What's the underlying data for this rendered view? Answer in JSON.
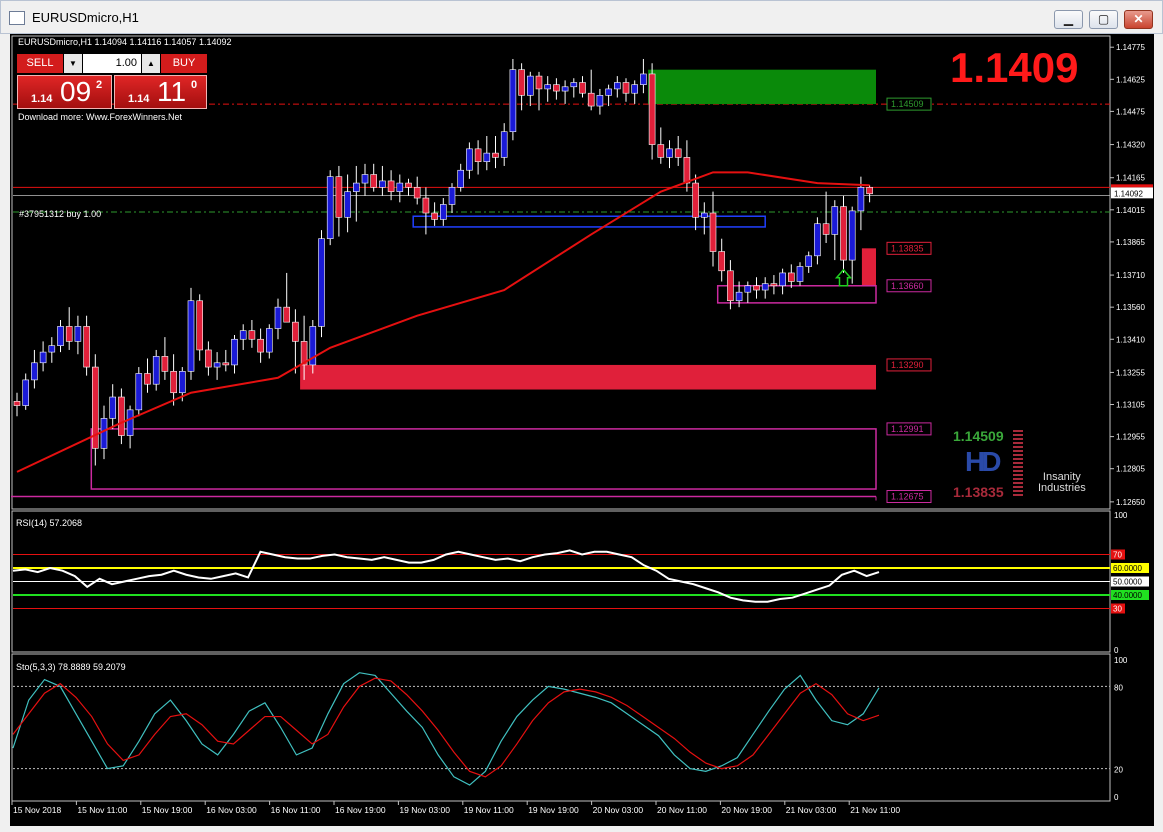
{
  "window": {
    "title": "EURUSDmicro,H1",
    "minimize": "▁",
    "maximize": "▢",
    "close": "✕"
  },
  "header": {
    "symbol_line": "EURUSDmicro,H1  1.14094 1.14116 1.14057 1.14092",
    "download": "Download more: Www.ForexWinners.Net"
  },
  "trade_panel": {
    "sell_label": "SELL",
    "buy_label": "BUY",
    "volume": "1.00",
    "sell_price": {
      "prefix": "1.14",
      "big": "09",
      "sup": "2"
    },
    "buy_price": {
      "prefix": "1.14",
      "big": "11",
      "sup": "0"
    }
  },
  "big_price": "1.1409",
  "order_label": "#37951312 buy 1.00",
  "rsi_label": "RSI(14) 57.2068",
  "sto_label": "Sto(5,3,3) 78.8889 59.2079",
  "hd_widget": {
    "upper": "1.14509",
    "lower": "1.13835"
  },
  "brand": {
    "line1": "Insanity",
    "line2": "Industries"
  },
  "colors": {
    "bull": "#1a1ad6",
    "bear": "#e0203a",
    "ma": "#e51010",
    "rsi": "#ffffff",
    "sto_main": "#40c0c0",
    "sto_signal": "#e51010"
  },
  "chart_data": [
    {
      "type": "candlestick",
      "name": "EURUSDmicro H1",
      "x_tick_labels": [
        "15 Nov 2018",
        "15 Nov 11:00",
        "15 Nov 19:00",
        "16 Nov 03:00",
        "16 Nov 11:00",
        "16 Nov 19:00",
        "19 Nov 03:00",
        "19 Nov 11:00",
        "19 Nov 19:00",
        "20 Nov 03:00",
        "20 Nov 11:00",
        "20 Nov 19:00",
        "21 Nov 03:00",
        "21 Nov 11:00"
      ],
      "y_tick_labels": [
        "1.14775",
        "1.14625",
        "1.14475",
        "1.14320",
        "1.14165",
        "1.14015",
        "1.13865",
        "1.13710",
        "1.13560",
        "1.13410",
        "1.13255",
        "1.13105",
        "1.12955",
        "1.12805",
        "1.12650"
      ],
      "ylim": [
        1.1264,
        1.1479
      ],
      "current_price_label": "1.14092",
      "ohlc": [
        [
          1.1312,
          1.1316,
          1.1305,
          1.131
        ],
        [
          1.131,
          1.1325,
          1.1308,
          1.1322
        ],
        [
          1.1322,
          1.1336,
          1.1318,
          1.133
        ],
        [
          1.133,
          1.134,
          1.1326,
          1.1335
        ],
        [
          1.1335,
          1.1342,
          1.133,
          1.1338
        ],
        [
          1.1338,
          1.135,
          1.1335,
          1.1347
        ],
        [
          1.1347,
          1.1356,
          1.1336,
          1.134
        ],
        [
          1.134,
          1.1352,
          1.1334,
          1.1347
        ],
        [
          1.1347,
          1.1352,
          1.1324,
          1.1328
        ],
        [
          1.1328,
          1.1334,
          1.1282,
          1.129
        ],
        [
          1.129,
          1.131,
          1.1285,
          1.1304
        ],
        [
          1.1304,
          1.132,
          1.1299,
          1.1314
        ],
        [
          1.1314,
          1.1318,
          1.1292,
          1.1296
        ],
        [
          1.1296,
          1.131,
          1.129,
          1.1308
        ],
        [
          1.1308,
          1.1328,
          1.1305,
          1.1325
        ],
        [
          1.1325,
          1.1332,
          1.1316,
          1.132
        ],
        [
          1.132,
          1.1336,
          1.1317,
          1.1333
        ],
        [
          1.1333,
          1.1342,
          1.1322,
          1.1326
        ],
        [
          1.1326,
          1.1334,
          1.131,
          1.1316
        ],
        [
          1.1316,
          1.1328,
          1.1312,
          1.1326
        ],
        [
          1.1326,
          1.1365,
          1.1322,
          1.1359
        ],
        [
          1.1359,
          1.1362,
          1.1331,
          1.1336
        ],
        [
          1.1336,
          1.134,
          1.1324,
          1.1328
        ],
        [
          1.1328,
          1.1335,
          1.1322,
          1.133
        ],
        [
          1.133,
          1.1336,
          1.1326,
          1.1329
        ],
        [
          1.1329,
          1.1343,
          1.1325,
          1.1341
        ],
        [
          1.1341,
          1.1348,
          1.1336,
          1.1345
        ],
        [
          1.1345,
          1.135,
          1.1337,
          1.1341
        ],
        [
          1.1341,
          1.1346,
          1.133,
          1.1335
        ],
        [
          1.1335,
          1.1348,
          1.1332,
          1.1346
        ],
        [
          1.1346,
          1.136,
          1.1341,
          1.1356
        ],
        [
          1.1356,
          1.1372,
          1.135,
          1.1349
        ],
        [
          1.1349,
          1.1355,
          1.1325,
          1.134
        ],
        [
          1.134,
          1.1352,
          1.1322,
          1.1329
        ],
        [
          1.1329,
          1.135,
          1.1325,
          1.1347
        ],
        [
          1.1347,
          1.1392,
          1.1342,
          1.1388
        ],
        [
          1.1388,
          1.142,
          1.1385,
          1.1417
        ],
        [
          1.1417,
          1.1422,
          1.1389,
          1.1398
        ],
        [
          1.1398,
          1.1418,
          1.1391,
          1.141
        ],
        [
          1.141,
          1.1422,
          1.1396,
          1.1414
        ],
        [
          1.1414,
          1.1423,
          1.1408,
          1.1418
        ],
        [
          1.1418,
          1.1423,
          1.141,
          1.1412
        ],
        [
          1.1412,
          1.1422,
          1.1408,
          1.1415
        ],
        [
          1.1415,
          1.142,
          1.1406,
          1.141
        ],
        [
          1.141,
          1.1418,
          1.1405,
          1.1414
        ],
        [
          1.1414,
          1.1416,
          1.1408,
          1.1412
        ],
        [
          1.1412,
          1.1417,
          1.1404,
          1.1407
        ],
        [
          1.1407,
          1.1412,
          1.139,
          1.14
        ],
        [
          1.14,
          1.1405,
          1.1394,
          1.1397
        ],
        [
          1.1397,
          1.1407,
          1.1394,
          1.1404
        ],
        [
          1.1404,
          1.1414,
          1.14,
          1.1412
        ],
        [
          1.1412,
          1.1423,
          1.141,
          1.142
        ],
        [
          1.142,
          1.1433,
          1.1416,
          1.143
        ],
        [
          1.143,
          1.1434,
          1.1418,
          1.1424
        ],
        [
          1.1424,
          1.1436,
          1.142,
          1.1428
        ],
        [
          1.1428,
          1.1436,
          1.1421,
          1.1426
        ],
        [
          1.1426,
          1.1442,
          1.1422,
          1.1438
        ],
        [
          1.1438,
          1.1472,
          1.1434,
          1.1467
        ],
        [
          1.1467,
          1.147,
          1.1448,
          1.1455
        ],
        [
          1.1455,
          1.1466,
          1.145,
          1.1464
        ],
        [
          1.1464,
          1.1466,
          1.1448,
          1.1458
        ],
        [
          1.1458,
          1.1464,
          1.1452,
          1.146
        ],
        [
          1.146,
          1.1463,
          1.1453,
          1.1457
        ],
        [
          1.1457,
          1.1462,
          1.1451,
          1.1459
        ],
        [
          1.1459,
          1.1463,
          1.1454,
          1.1461
        ],
        [
          1.1461,
          1.1464,
          1.1454,
          1.1456
        ],
        [
          1.1456,
          1.1467,
          1.1448,
          1.145
        ],
        [
          1.145,
          1.1458,
          1.1446,
          1.1455
        ],
        [
          1.1455,
          1.146,
          1.145,
          1.1458
        ],
        [
          1.1458,
          1.1464,
          1.1454,
          1.1461
        ],
        [
          1.1461,
          1.1463,
          1.1452,
          1.1456
        ],
        [
          1.1456,
          1.1462,
          1.1451,
          1.146
        ],
        [
          1.146,
          1.1472,
          1.1456,
          1.1465
        ],
        [
          1.1465,
          1.147,
          1.1425,
          1.1432
        ],
        [
          1.1432,
          1.144,
          1.1423,
          1.1426
        ],
        [
          1.1426,
          1.1434,
          1.1421,
          1.143
        ],
        [
          1.143,
          1.1436,
          1.1422,
          1.1426
        ],
        [
          1.1426,
          1.1434,
          1.141,
          1.1414
        ],
        [
          1.1414,
          1.1418,
          1.1392,
          1.1398
        ],
        [
          1.1398,
          1.1405,
          1.139,
          1.14
        ],
        [
          1.14,
          1.141,
          1.1375,
          1.1382
        ],
        [
          1.1382,
          1.1388,
          1.1368,
          1.1373
        ],
        [
          1.1373,
          1.1378,
          1.1355,
          1.1359
        ],
        [
          1.1359,
          1.1368,
          1.1356,
          1.1363
        ],
        [
          1.1363,
          1.1368,
          1.1358,
          1.1366
        ],
        [
          1.1366,
          1.137,
          1.136,
          1.1364
        ],
        [
          1.1364,
          1.137,
          1.136,
          1.1367
        ],
        [
          1.1367,
          1.1371,
          1.1362,
          1.1366
        ],
        [
          1.1366,
          1.1374,
          1.1362,
          1.1372
        ],
        [
          1.1372,
          1.1376,
          1.1365,
          1.1368
        ],
        [
          1.1368,
          1.1377,
          1.1366,
          1.1375
        ],
        [
          1.1375,
          1.1382,
          1.1372,
          1.138
        ],
        [
          1.138,
          1.1398,
          1.1376,
          1.1395
        ],
        [
          1.1395,
          1.141,
          1.1386,
          1.139
        ],
        [
          1.139,
          1.1406,
          1.1378,
          1.1403
        ],
        [
          1.1403,
          1.1408,
          1.1372,
          1.1378
        ],
        [
          1.1378,
          1.1403,
          1.1367,
          1.1401
        ],
        [
          1.1401,
          1.1417,
          1.1392,
          1.1412
        ],
        [
          1.1412,
          1.1413,
          1.1405,
          1.1409
        ]
      ],
      "moving_average": [
        [
          0,
          1.1279
        ],
        [
          12,
          1.1302
        ],
        [
          20,
          1.1316
        ],
        [
          30,
          1.1323
        ],
        [
          36,
          1.1337
        ],
        [
          46,
          1.1352
        ],
        [
          56,
          1.1364
        ],
        [
          66,
          1.139
        ],
        [
          74,
          1.141
        ],
        [
          80,
          1.1419
        ],
        [
          84,
          1.1419
        ],
        [
          92,
          1.1414
        ],
        [
          98,
          1.1413
        ]
      ],
      "price_levels": [
        {
          "label": "1.14509",
          "color": "#2e9a2e"
        },
        {
          "label": "1.13835",
          "color": "#e0203a"
        },
        {
          "label": "1.13660",
          "color": "#cc2aa0"
        },
        {
          "label": "1.13290",
          "color": "#e0203a"
        },
        {
          "label": "1.12991",
          "color": "#cc2aa0"
        },
        {
          "label": "1.12675",
          "color": "#cc2aa0"
        }
      ]
    },
    {
      "type": "line",
      "name": "RSI(14)",
      "ylim": [
        0,
        100
      ],
      "y_tick_labels": [
        "100",
        "0"
      ],
      "levels": [
        "70",
        "60.0000",
        "50.0000",
        "40.0000",
        "30"
      ],
      "values": [
        58,
        59,
        57,
        60,
        58,
        54,
        46,
        52,
        48,
        50,
        52,
        54,
        55,
        58,
        55,
        53,
        52,
        54,
        56,
        53,
        72,
        70,
        68,
        67,
        67,
        69,
        70,
        68,
        67,
        66,
        68,
        66,
        64,
        64,
        66,
        70,
        72,
        70,
        68,
        66,
        67,
        65,
        68,
        70,
        71,
        73,
        70,
        72,
        72,
        70,
        68,
        62,
        58,
        52,
        50,
        48,
        45,
        42,
        38,
        36,
        35,
        35,
        37,
        38,
        41,
        44,
        47,
        55,
        58,
        54,
        57
      ]
    },
    {
      "type": "line",
      "name": "Sto(5,3,3)",
      "ylim": [
        0,
        100
      ],
      "y_tick_labels": [
        "100",
        "80",
        "20",
        "0"
      ],
      "levels": [
        "80",
        "20"
      ],
      "series": [
        {
          "name": "main",
          "values": [
            35,
            70,
            85,
            80,
            60,
            40,
            20,
            22,
            40,
            60,
            70,
            55,
            38,
            30,
            45,
            62,
            68,
            50,
            30,
            35,
            60,
            82,
            90,
            88,
            75,
            62,
            50,
            30,
            14,
            8,
            18,
            40,
            58,
            70,
            80,
            78,
            75,
            72,
            68,
            60,
            52,
            44,
            30,
            20,
            18,
            22,
            28,
            45,
            62,
            78,
            88,
            70,
            55,
            52,
            60,
            79
          ]
        },
        {
          "name": "signal",
          "values": [
            45,
            60,
            75,
            82,
            72,
            58,
            38,
            26,
            30,
            45,
            58,
            60,
            52,
            40,
            38,
            48,
            58,
            58,
            48,
            38,
            45,
            65,
            80,
            86,
            84,
            74,
            62,
            48,
            32,
            18,
            14,
            22,
            38,
            55,
            68,
            76,
            78,
            76,
            72,
            66,
            58,
            50,
            42,
            32,
            24,
            20,
            22,
            30,
            45,
            60,
            75,
            82,
            74,
            60,
            55,
            59
          ]
        }
      ]
    }
  ]
}
